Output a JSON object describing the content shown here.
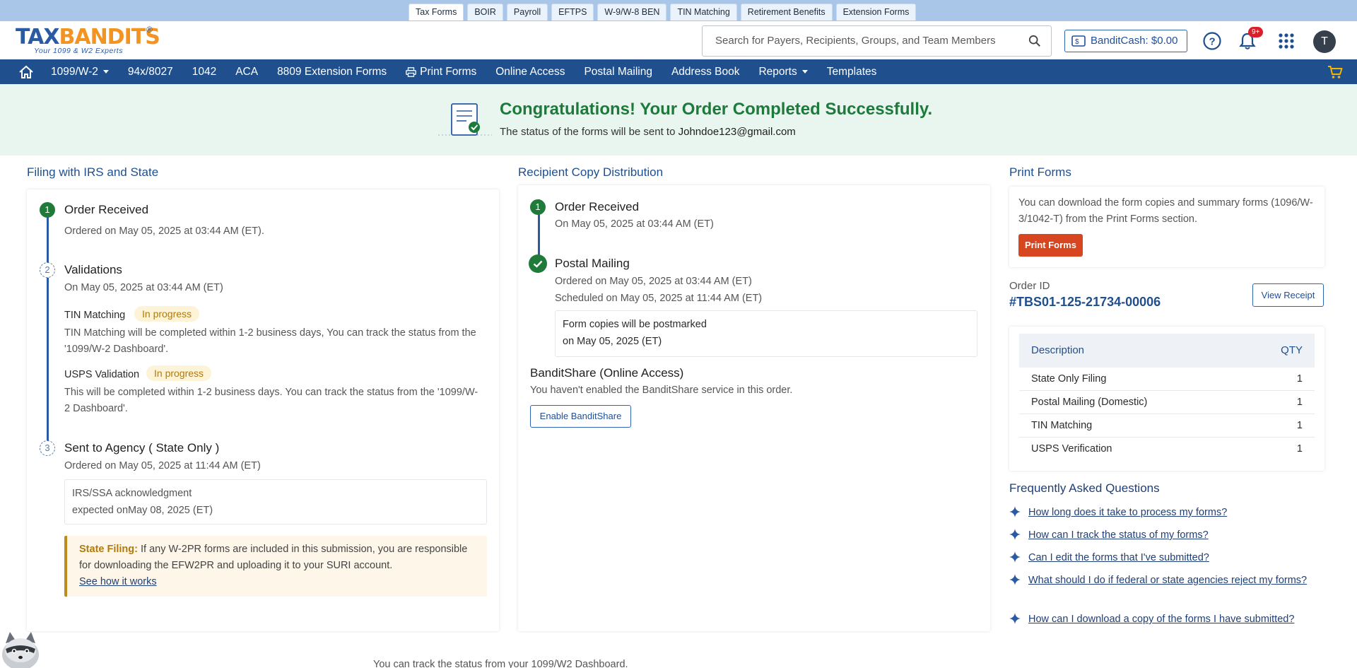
{
  "top_tabs": [
    "Tax Forms",
    "BOIR",
    "Payroll",
    "EFTPS",
    "W-9/W-8 BEN",
    "TIN Matching",
    "Retirement Benefits",
    "Extension Forms"
  ],
  "header": {
    "logo_text_1": "TAX",
    "logo_text_2": "BANDITS",
    "logo_reg": "®",
    "logo_tagline": "Your 1099 & W2 Experts",
    "search_placeholder": "Search for Payers, Recipients, Groups, and Team Members",
    "bandit_cash": "BanditCash: $0.00",
    "notification_count": "9+",
    "avatar_initial": "T"
  },
  "nav": {
    "items": [
      "1099/W-2",
      "94x/8027",
      "1042",
      "ACA",
      "8809 Extension Forms",
      "Print Forms",
      "Online Access",
      "Postal Mailing",
      "Address Book",
      "Reports",
      "Templates"
    ]
  },
  "banner": {
    "title": "Congratulations! Your Order Completed Successfully.",
    "subtitle": "The status of the forms will be sent to",
    "email": "Johndoe123@gmail.com"
  },
  "filing": {
    "title": "Filing with IRS and State",
    "step1": {
      "num": "1",
      "title": "Order Received",
      "text": "Ordered on May 05, 2025 at 03:44 AM (ET)."
    },
    "step2": {
      "num": "2",
      "title": "Validations",
      "text": "On May 05, 2025 at 03:44 AM (ET)",
      "tin_label": "TIN Matching",
      "tin_status": "In progress",
      "tin_text": "TIN Matching will be completed within 1-2 business days, You can track the status from the '1099/W-2 Dashboard'.",
      "usps_label": "USPS Validation",
      "usps_status": "In progress",
      "usps_text": "This will be completed within 1-2 business days. You can track the status from the '1099/W-2 Dashboard'."
    },
    "step3": {
      "num": "3",
      "title": "Sent to Agency ( State Only )",
      "text": "Ordered on May 05, 2025 at 11:44 AM (ET)",
      "ack_line1": "IRS/SSA acknowledgment",
      "ack_line2": "expected onMay 08, 2025 (ET)"
    },
    "note_label": "State Filing:",
    "note_text": " If any W-2PR forms are included in this submission, you are responsible for downloading the EFW2PR and uploading it to your SURI account.",
    "note_link": "See how it works"
  },
  "recipient": {
    "title": "Recipient Copy Distribution",
    "step1": {
      "num": "1",
      "title": "Order Received",
      "text": "On May 05, 2025 at 03:44 AM (ET)"
    },
    "step2": {
      "title": "Postal Mailing",
      "text1": "Ordered on May 05, 2025 at 03:44 AM (ET)",
      "text2": "Scheduled on May 05, 2025 at 11:44 AM (ET)",
      "box_line1": "Form copies will be postmarked",
      "box_line2": "on May 05, 2025 (ET)"
    },
    "share_title": "BanditShare (Online Access)",
    "share_text": "You haven't enabled the BanditShare service in this order.",
    "share_button": "Enable BanditShare"
  },
  "print": {
    "title": "Print Forms",
    "text": "You can download the form copies and summary forms (1096/W-3/1042-T) from the Print Forms section.",
    "button": "Print Forms",
    "order_id_label": "Order ID",
    "order_id": "#TBS01-125-21734-00006",
    "view_receipt": "View Receipt",
    "table_headers": {
      "description": "Description",
      "qty": "QTY"
    },
    "table_rows": [
      {
        "description": "State Only Filing",
        "qty": "1"
      },
      {
        "description": "Postal Mailing (Domestic)",
        "qty": "1"
      },
      {
        "description": "TIN Matching",
        "qty": "1"
      },
      {
        "description": "USPS Verification",
        "qty": "1"
      }
    ]
  },
  "faq": {
    "title": "Frequently Asked Questions",
    "items": [
      "How long does it take to process my forms?",
      "How can I track the status of my forms?",
      "Can I edit the forms that I've submitted?",
      "What should I do if federal or state agencies reject my forms?",
      "How can I download a copy of the forms I have submitted?"
    ]
  },
  "bottom_text": "You can track the status from your 1099/W2 Dashboard.",
  "colors": {
    "nav": "#1f4f8d",
    "success": "#1c7a3b",
    "accent": "#d8461f",
    "banner_bg": "#e9f6ef"
  }
}
